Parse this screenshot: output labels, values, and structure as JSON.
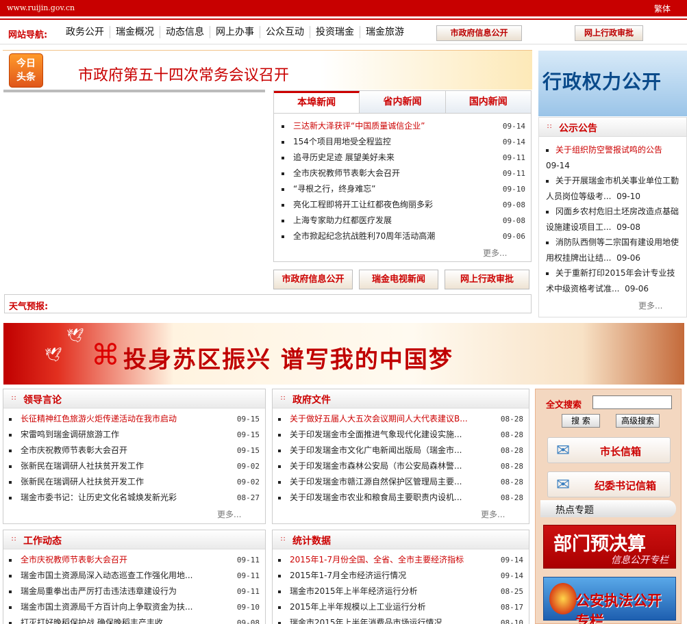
{
  "site": {
    "url": "www.ruijin.gov.cn",
    "traditional": "繁体"
  },
  "nav": {
    "label": "网站导航:",
    "items": [
      "政务公开",
      "瑞金概况",
      "动态信息",
      "网上办事",
      "公众互动",
      "投资瑞金",
      "瑞金旅游"
    ],
    "btn_info": "市政府信息公开",
    "btn_approval": "网上行政审批"
  },
  "headline": {
    "tag_line1": "今日",
    "tag_line2": "头条",
    "title": "市政府第五十四次常务会议召开"
  },
  "news": {
    "tabs": [
      "本埠新闻",
      "省内新闻",
      "国内新闻"
    ],
    "items": [
      {
        "title": "三达新大泽获评“中国质量诚信企业”",
        "date": "09-14"
      },
      {
        "title": "154个项目用地受全程监控",
        "date": "09-14"
      },
      {
        "title": "追寻历史足迹 展望美好未来",
        "date": "09-11"
      },
      {
        "title": "全市庆祝教师节表彰大会召开",
        "date": "09-11"
      },
      {
        "title": "“寻根之行，终身难忘”",
        "date": "09-10"
      },
      {
        "title": "亮化工程即将开工让红都夜色绚丽多彩",
        "date": "09-08"
      },
      {
        "title": "上海专家助力红都医疗发展",
        "date": "09-08"
      },
      {
        "title": "全市掀起纪念抗战胜利70周年活动高潮",
        "date": "09-06"
      }
    ],
    "more": "更多..."
  },
  "quick_buttons": [
    "市政府信息公开",
    "瑞金电视新闻",
    "网上行政审批"
  ],
  "weather": {
    "label": "天气预报:"
  },
  "power_banner": "行政权力公开",
  "notice": {
    "title": "公示公告",
    "items": [
      {
        "title": "关于组织防空警报试鸣的公告",
        "date": "09-14"
      },
      {
        "title": "关于开展瑞金市机关事业单位工勤人员岗位等级考...",
        "date": "09-10"
      },
      {
        "title": "冈面乡农村危旧土坯房改造点基础设施建设项目工...",
        "date": "09-08"
      },
      {
        "title": "消防队西侧等二宗国有建设用地使用权挂牌出让结...",
        "date": "09-06"
      },
      {
        "title": "关于重新打印2015年会计专业技术中级资格考试准...",
        "date": "09-06"
      }
    ],
    "more": "更多..."
  },
  "banner": {
    "slogan": "投身苏区振兴 谱写我的中国梦"
  },
  "leaders": {
    "title": "领导言论",
    "items": [
      {
        "title": "长征精神红色旅游火炬传递活动在我市启动",
        "date": "09-15"
      },
      {
        "title": "宋雷鸣到瑞金调研旅游工作",
        "date": "09-15"
      },
      {
        "title": "全市庆祝教师节表彰大会召开",
        "date": "09-15"
      },
      {
        "title": "张新民在瑞调研人社扶贫开发工作",
        "date": "09-02"
      },
      {
        "title": "张新民在瑞调研人社扶贫开发工作",
        "date": "09-02"
      },
      {
        "title": "瑞金市委书记：让历史文化名城焕发新光彩",
        "date": "08-27"
      }
    ],
    "more": "更多..."
  },
  "docs": {
    "title": "政府文件",
    "items": [
      {
        "title": "关于做好五届人大五次会议期间人大代表建议B...",
        "date": "08-28"
      },
      {
        "title": "关于印发瑞金市全面推进气象现代化建设实施...",
        "date": "08-28"
      },
      {
        "title": "关于印发瑞金市文化广电新闻出版局（瑞金市...",
        "date": "08-28"
      },
      {
        "title": "关于印发瑞金市森林公安局（市公安局森林警...",
        "date": "08-28"
      },
      {
        "title": "关于印发瑞金市赣江源自然保护区管理局主要...",
        "date": "08-28"
      },
      {
        "title": "关于印发瑞金市农业和粮食局主要职责内设机...",
        "date": "08-28"
      }
    ],
    "more": "更多..."
  },
  "work": {
    "title": "工作动态",
    "items": [
      {
        "title": "全市庆祝教师节表彰大会召开",
        "date": "09-11"
      },
      {
        "title": "瑞金市国土资源局深入动态巡查工作强化用地...",
        "date": "09-11"
      },
      {
        "title": "瑞金局重拳出击严厉打击违法违章建设行为",
        "date": "09-11"
      },
      {
        "title": "瑞金市国土资源局千方百计向上争取资金为扶...",
        "date": "09-10"
      },
      {
        "title": "打灭打好晚稻保护战 确保晚稻丰产丰收",
        "date": "09-08"
      }
    ]
  },
  "stats": {
    "title": "统计数据",
    "items": [
      {
        "title": "2015年1-7月份全国、全省、全市主要经济指标",
        "date": "09-14"
      },
      {
        "title": "2015年1-7月全市经济运行情况",
        "date": "09-14"
      },
      {
        "title": "瑞金市2015年上半年经济运行分析",
        "date": "08-25"
      },
      {
        "title": "2015年上半年规模以上工业运行分析",
        "date": "08-17"
      },
      {
        "title": "瑞金市2015年上半年消费品市场运行情况",
        "date": "08-10"
      }
    ]
  },
  "side": {
    "fulltext": "全文搜索",
    "search": "搜 索",
    "advanced": "高级搜索",
    "mayor_mail": "市长信箱",
    "discipline_mail": "纪委书记信箱",
    "hot_topics": "热点专题",
    "budget_a": "部门预决算",
    "budget_b": "信息公开专栏",
    "police": "公安执法公开专栏"
  }
}
